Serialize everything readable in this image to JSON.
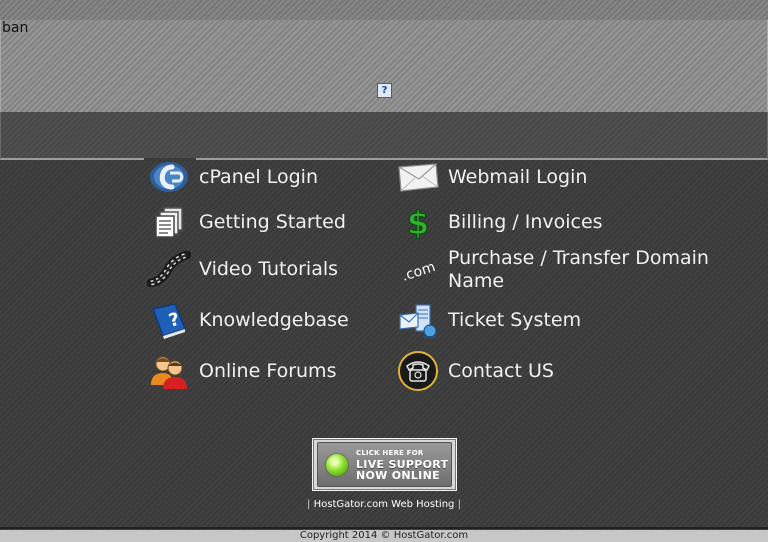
{
  "banner": {
    "text": "ban",
    "help_icon_text": "?"
  },
  "menu": {
    "left": [
      {
        "label": "cPanel Login",
        "icon": "cpanel-icon"
      },
      {
        "label": "Getting Started",
        "icon": "documents-icon"
      },
      {
        "label": "Video Tutorials",
        "icon": "film-strip-icon"
      },
      {
        "label": "Knowledgebase",
        "icon": "help-book-icon"
      },
      {
        "label": "Online Forums",
        "icon": "users-icon"
      }
    ],
    "right": [
      {
        "label": "Webmail Login",
        "icon": "envelope-icon"
      },
      {
        "label": "Billing / Invoices",
        "icon": "dollar-icon"
      },
      {
        "label": "Purchase / Transfer Domain Name",
        "icon": "dotcom-icon",
        "icon_text": ".com"
      },
      {
        "label": "Ticket System",
        "icon": "ticket-icon"
      },
      {
        "label": "Contact US",
        "icon": "telephone-icon"
      }
    ]
  },
  "live_support": {
    "line1": "CLICK HERE FOR",
    "line2": "LIVE SUPPORT",
    "line3": "NOW ONLINE"
  },
  "footer": {
    "separator": "|",
    "link": "HostGator.com Web Hosting",
    "copyright": "Copyright 2014 © HostGator.com"
  }
}
